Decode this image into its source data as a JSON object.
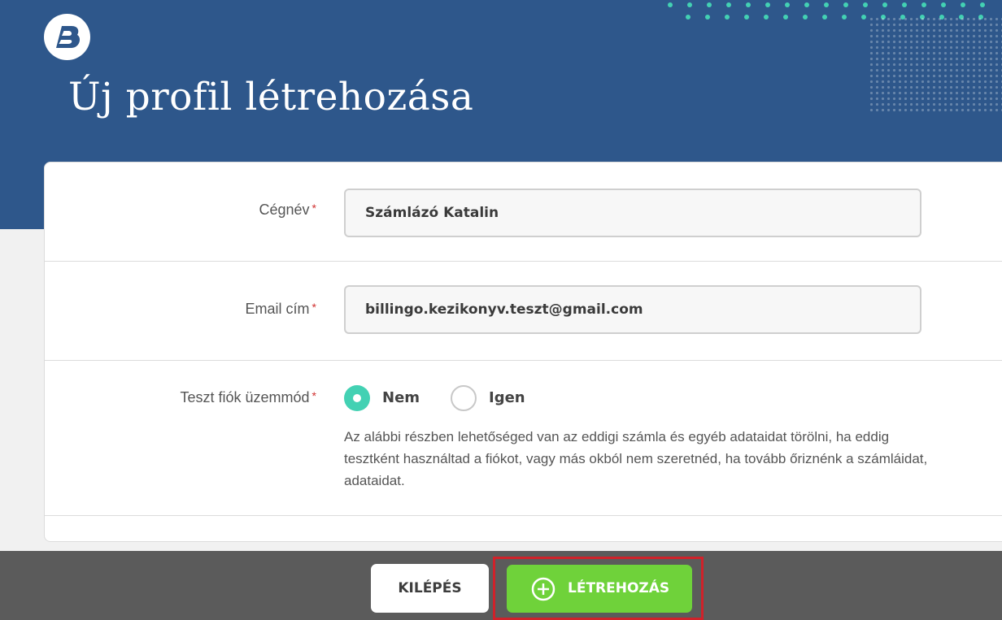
{
  "header": {
    "title": "Új profil létrehozása",
    "logo_icon": "billingo-b-logo-icon",
    "background_color": "#2e578b"
  },
  "form": {
    "company_name": {
      "label": "Cégnév",
      "required_mark": "*",
      "value": "Számlázó Katalin"
    },
    "email": {
      "label": "Email cím",
      "required_mark": "*",
      "value": "billingo.kezikonyv.teszt@gmail.com"
    },
    "test_mode": {
      "label": "Teszt fiók üzemmód",
      "required_mark": "*",
      "options": [
        {
          "label": "Nem",
          "checked": true
        },
        {
          "label": "Igen",
          "checked": false
        }
      ],
      "help_text": "Az alábbi részben lehetőséged van az eddigi számla és egyéb adataidat törölni, ha eddig tesztként használtad a fiókot, vagy más okból nem szeretnéd, ha tovább őriznénk a számláidat, adataidat."
    }
  },
  "footer": {
    "exit_label": "KILÉPÉS",
    "create_label": "LÉTREHOZÁS",
    "create_icon": "plus-circle-icon",
    "create_color": "#6fd23a",
    "highlight_color": "#d0222a"
  },
  "colors": {
    "accent_teal": "#43d1b3",
    "required": "#d0302f"
  }
}
